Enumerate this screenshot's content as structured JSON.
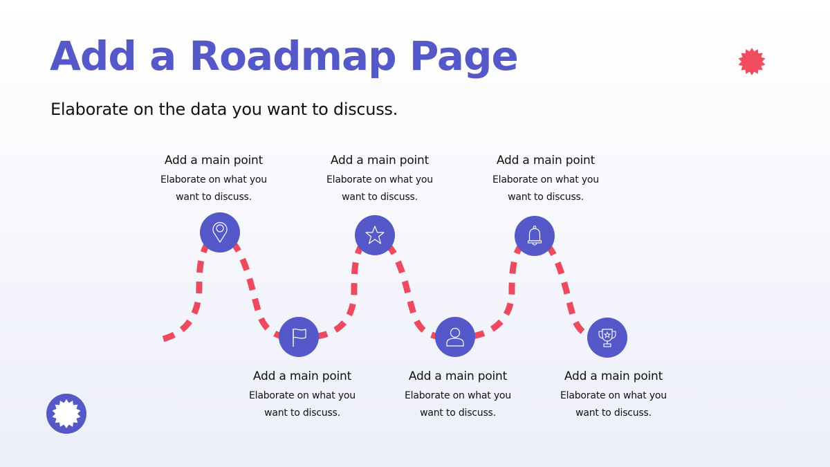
{
  "slide": {
    "title": "Add a Roadmap Page",
    "subtitle": "Elaborate on the data you want to discuss.",
    "colors": {
      "accent": "#5558c9",
      "path": "#ee4a5f",
      "burst_red": "#f24d5e",
      "text": "#111111"
    }
  },
  "decorations": {
    "top_right": "burst-red-icon",
    "bottom_left": "burst-badge-icon"
  },
  "milestones": [
    {
      "icon": "location-pin-icon",
      "heading": "Add a main point",
      "line1": "Elaborate on what you",
      "line2": "want to discuss.",
      "position": "above"
    },
    {
      "icon": "flag-icon",
      "heading": "Add a main point",
      "line1": "Elaborate on what you",
      "line2": "want to discuss.",
      "position": "below"
    },
    {
      "icon": "star-icon",
      "heading": "Add a main point",
      "line1": "Elaborate on what you",
      "line2": "want to discuss.",
      "position": "above"
    },
    {
      "icon": "person-icon",
      "heading": "Add a main point",
      "line1": "Elaborate on what you",
      "line2": "want to discuss.",
      "position": "below"
    },
    {
      "icon": "bell-icon",
      "heading": "Add a main point",
      "line1": "Elaborate on what you",
      "line2": "want to discuss.",
      "position": "above"
    },
    {
      "icon": "trophy-icon",
      "heading": "Add a main point",
      "line1": "Elaborate on what you",
      "line2": "want to discuss.",
      "position": "below"
    }
  ]
}
